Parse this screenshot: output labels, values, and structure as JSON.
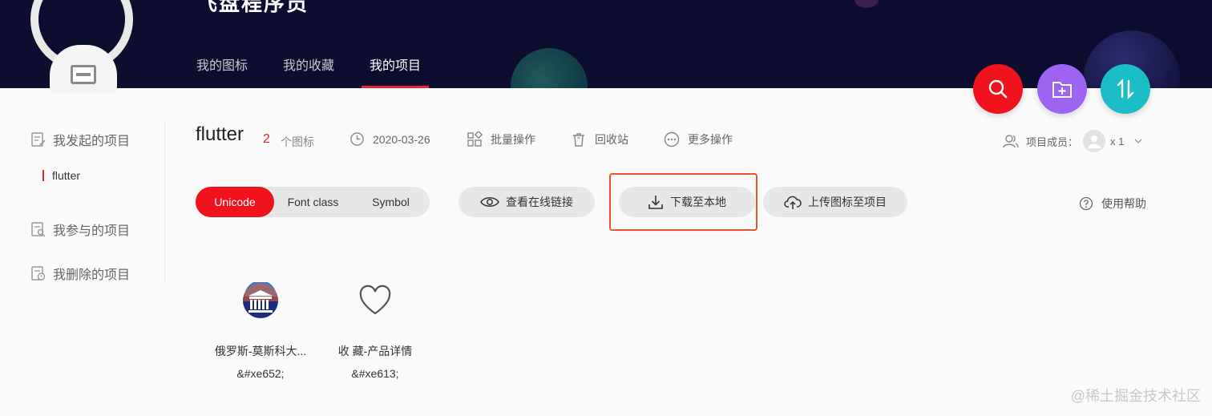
{
  "header": {
    "title": "飞盘程序员",
    "tabs": [
      {
        "label": "我的图标",
        "active": false
      },
      {
        "label": "我的收藏",
        "active": false
      },
      {
        "label": "我的项目",
        "active": true
      }
    ],
    "fabs": [
      {
        "name": "search",
        "color": "#f0131e"
      },
      {
        "name": "add-folder",
        "color": "#9f63f1"
      },
      {
        "name": "sort",
        "color": "#1bbec6"
      }
    ]
  },
  "sidebar": {
    "my_projects": "我发起的项目",
    "selected_project": "flutter",
    "joined_projects": "我参与的项目",
    "deleted_projects": "我删除的项目"
  },
  "project": {
    "name": "flutter",
    "icon_count": "2",
    "icon_unit": "个图标",
    "date": "2020-03-26",
    "batch_ops": "批量操作",
    "recycle_bin": "回收站",
    "more_ops": "更多操作",
    "members_label": "项目成员：",
    "members_count": "x 1"
  },
  "toolbar": {
    "font_types": [
      {
        "label": "Unicode",
        "active": true
      },
      {
        "label": "Font class",
        "active": false
      },
      {
        "label": "Symbol",
        "active": false
      }
    ],
    "view_link": "查看在线链接",
    "download": "下载至本地",
    "upload": "上传图标至项目",
    "help": "使用帮助"
  },
  "icons": [
    {
      "name": "俄罗斯-莫斯科大...",
      "code": "&#xe652;",
      "icon": "moscow-university-icon"
    },
    {
      "name": "收 藏-产品详情",
      "code": "&#xe613;",
      "icon": "heart-icon"
    }
  ],
  "watermark": "@稀土掘金技术社区",
  "colors": {
    "accent": "#f0131e",
    "header_bg": "#0d0d30",
    "highlight_border": "#e8552a"
  }
}
